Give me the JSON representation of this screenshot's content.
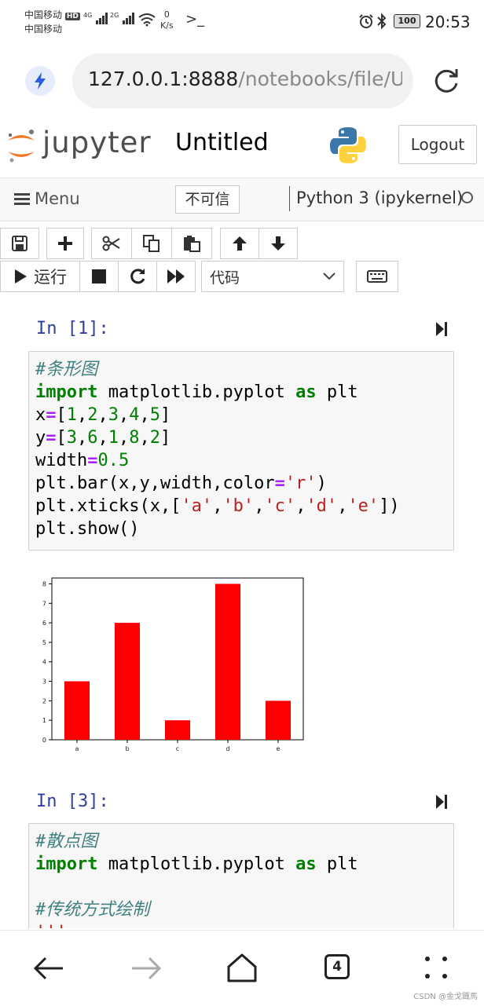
{
  "status_bar": {
    "carrier1": "中国移动",
    "carrier1_badge": "HD",
    "carrier2": "中国移动",
    "net1": "4G",
    "net2": "2G",
    "speed_value": "0",
    "speed_unit": "K/s",
    "battery": "100",
    "time": "20:53"
  },
  "browser": {
    "url_host": "127.0.0.1:8888",
    "url_path": "/notebooks/file/U"
  },
  "jupyter": {
    "logo_text": "jupyter",
    "notebook_title": "Untitled",
    "logout_label": "Logout",
    "menu_label": "Menu",
    "trust_label": "不可信",
    "kernel_name": "Python 3 (ipykernel)",
    "run_label": "运行",
    "cell_type": "代码"
  },
  "cells": [
    {
      "prompt": "In [1]:",
      "lines": [
        "#条形图",
        "import matplotlib.pyplot as plt",
        "x=[1,2,3,4,5]",
        "y=[3,6,1,8,2]",
        "width=0.5",
        "plt.bar(x,y,width,color='r')",
        "plt.xticks(x,['a','b','c','d','e'])",
        "plt.show()"
      ]
    },
    {
      "prompt": "In [3]:",
      "lines": [
        "#散点图",
        "import matplotlib.pyplot as plt",
        "",
        "#传统方式绘制",
        "'''"
      ]
    }
  ],
  "chart_data": {
    "type": "bar",
    "categories": [
      "a",
      "b",
      "c",
      "d",
      "e"
    ],
    "values": [
      3,
      6,
      1,
      8,
      2
    ],
    "color": "#ff0000",
    "ylim": [
      0,
      8.3
    ],
    "yticks": [
      "0",
      "1",
      "2",
      "3",
      "4",
      "5",
      "6",
      "7",
      "8"
    ],
    "title": "",
    "xlabel": "",
    "ylabel": ""
  },
  "bottom_nav": {
    "tab_count": "4"
  },
  "watermark": "CSDN @金戈鐡馬"
}
